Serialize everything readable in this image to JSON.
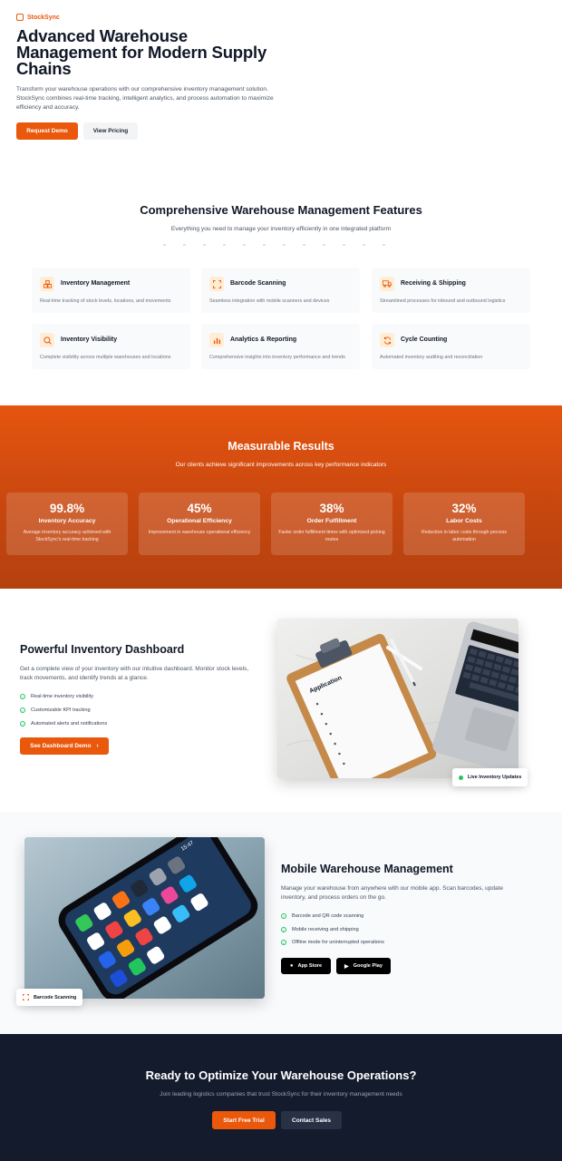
{
  "brand": {
    "name": "StockSync",
    "accent": "#ea580c"
  },
  "hero": {
    "title": "Advanced Warehouse Management for Modern Supply Chains",
    "description": "Transform your warehouse operations with our comprehensive inventory management solution. StockSync combines real-time tracking, intelligent analytics, and process automation to maximize efficiency and accuracy.",
    "primary_button": "Request Demo",
    "secondary_button": "View Pricing"
  },
  "features": {
    "title": "Comprehensive Warehouse Management Features",
    "subtitle": "Everything you need to manage your inventory efficiently in one integrated platform",
    "items": [
      {
        "icon": "boxes-icon",
        "title": "Inventory Management",
        "desc": "Real-time tracking of stock levels, locations, and movements"
      },
      {
        "icon": "scan-icon",
        "title": "Barcode Scanning",
        "desc": "Seamless integration with mobile scanners and devices"
      },
      {
        "icon": "truck-icon",
        "title": "Receiving & Shipping",
        "desc": "Streamlined processes for inbound and outbound logistics"
      },
      {
        "icon": "search-icon",
        "title": "Inventory Visibility",
        "desc": "Complete visibility across multiple warehouses and locations"
      },
      {
        "icon": "chart-icon",
        "title": "Analytics & Reporting",
        "desc": "Comprehensive insights into inventory performance and trends"
      },
      {
        "icon": "refresh-icon",
        "title": "Cycle Counting",
        "desc": "Automated inventory auditing and reconciliation"
      }
    ]
  },
  "results": {
    "title": "Measurable Results",
    "subtitle": "Our clients achieve significant improvements across key performance indicators",
    "stats": [
      {
        "value": "99.8%",
        "label": "Inventory Accuracy",
        "desc": "Average inventory accuracy achieved with StockSync's real-time tracking"
      },
      {
        "value": "45%",
        "label": "Operational Efficiency",
        "desc": "Improvement in warehouse operational efficiency"
      },
      {
        "value": "38%",
        "label": "Order Fulfillment",
        "desc": "Faster order fulfillment times with optimized picking routes"
      },
      {
        "value": "32%",
        "label": "Labor Costs",
        "desc": "Reduction in labor costs through process automation"
      }
    ]
  },
  "dashboard": {
    "title": "Powerful Inventory Dashboard",
    "description": "Get a complete view of your inventory with our intuitive dashboard. Monitor stock levels, track movements, and identify trends at a glance.",
    "checks": [
      "Real-time inventory visibility",
      "Customizable KPI tracking",
      "Automated alerts and notifications"
    ],
    "button": "See Dashboard Demo",
    "badge": "Live Inventory Updates",
    "clipboard_text": "Application"
  },
  "mobile": {
    "title": "Mobile Warehouse Management",
    "description": "Manage your warehouse from anywhere with our mobile app. Scan barcodes, update inventory, and process orders on the go.",
    "checks": [
      "Barcode and QR code scanning",
      "Mobile receiving and shipping",
      "Offline mode for uninterrupted operations"
    ],
    "app_store": "App Store",
    "google_play": "Google Play",
    "badge": "Barcode Scanning",
    "phone_time": "15:47"
  },
  "cta": {
    "title": "Ready to Optimize Your Warehouse Operations?",
    "subtitle": "Join leading logistics companies that trust StockSync for their inventory management needs",
    "primary_button": "Start Free Trial",
    "secondary_button": "Contact Sales"
  }
}
